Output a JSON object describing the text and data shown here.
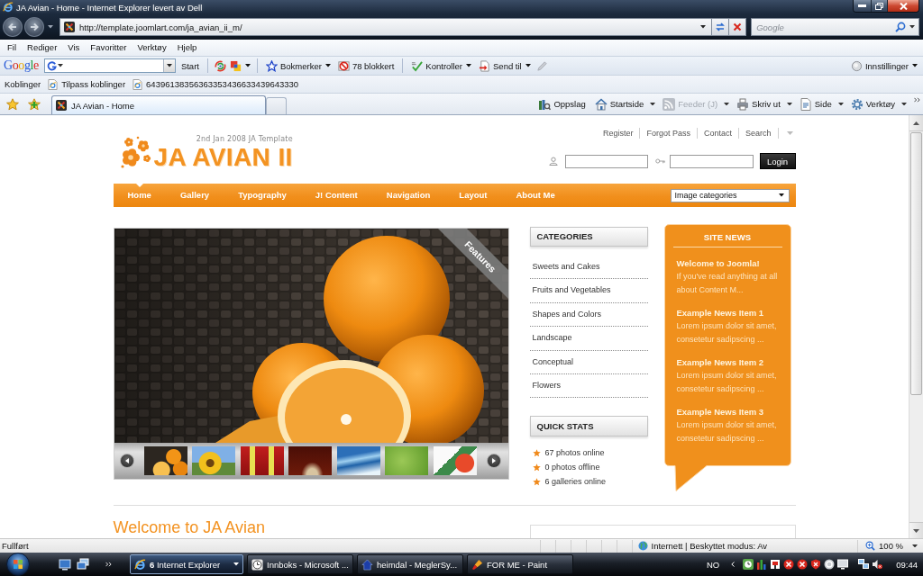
{
  "window": {
    "title": "JA Avian - Home - Internet Explorer levert av Dell"
  },
  "address_bar": {
    "url": "http://template.joomlart.com/ja_avian_ii_m/"
  },
  "search_box": {
    "placeholder": "Google"
  },
  "menu_bar": [
    "Fil",
    "Rediger",
    "Vis",
    "Favoritter",
    "Verktøy",
    "Hjelp"
  ],
  "google_toolbar": {
    "logo": "Google",
    "search_button": "Start",
    "bookmarks": "Bokmerker",
    "popups_blocked": "78 blokkert",
    "check": "Kontroller",
    "send_to": "Send til",
    "settings": "Innstillinger"
  },
  "links_bar": {
    "label": "Koblinger",
    "links": [
      "Tilpass koblinger",
      "64396138356363353436633439643330"
    ]
  },
  "tabs": [
    {
      "title": "JA Avian - Home",
      "selected": true
    }
  ],
  "command_bar": [
    {
      "label": "Oppslag",
      "dropdown": false,
      "disabled": false
    },
    {
      "label": "Startside",
      "dropdown": true,
      "disabled": false
    },
    {
      "label": "Feeder (J)",
      "dropdown": true,
      "disabled": true
    },
    {
      "label": "Skriv ut",
      "dropdown": true,
      "disabled": false
    },
    {
      "label": "Side",
      "dropdown": true,
      "disabled": false
    },
    {
      "label": "Verktøy",
      "dropdown": true,
      "disabled": false
    }
  ],
  "page": {
    "header": {
      "date_line": "2nd Jan 2008 JA Template",
      "logo": "JA AVIAN II",
      "top_links": [
        "Register",
        "Forgot Pass",
        "Contact",
        "Search"
      ],
      "login_button": "Login"
    },
    "nav": {
      "items": [
        {
          "label": "Home",
          "selected": true
        },
        {
          "label": "Gallery",
          "selected": false
        },
        {
          "label": "Typography",
          "selected": false
        },
        {
          "label": "J! Content",
          "selected": false
        },
        {
          "label": "Navigation",
          "selected": false
        },
        {
          "label": "Layout",
          "selected": false
        },
        {
          "label": "About Me",
          "selected": false
        }
      ],
      "category_select": "Image categories"
    },
    "slideshow": {
      "ribbon": "Features"
    },
    "categories": {
      "title": "CATEGORIES",
      "items": [
        "Sweets and Cakes",
        "Fruits and Vegetables",
        "Shapes and Colors",
        "Landscape",
        "Conceptual",
        "Flowers"
      ]
    },
    "quick_stats": {
      "title": "QUICK STATS",
      "items": [
        "67 photos online",
        "0 photos offline",
        "6 galleries online"
      ]
    },
    "site_news": {
      "title": "SITE NEWS",
      "items": [
        {
          "title": "Welcome to Joomla!",
          "summary": "If you've read anything at all about Content M..."
        },
        {
          "title": "Example News Item 1",
          "summary": "Lorem ipsum dolor sit amet, consetetur sadipscing ..."
        },
        {
          "title": "Example News Item 2",
          "summary": "Lorem ipsum dolor sit amet, consetetur sadipscing ..."
        },
        {
          "title": "Example News Item 3",
          "summary": "Lorem ipsum dolor sit amet, consetetur sadipscing ..."
        }
      ]
    },
    "welcome": {
      "heading": "Welcome to JA Avian"
    }
  },
  "status_bar": {
    "text": "Fullført",
    "zone": "Internett | Beskyttet modus: Av",
    "zoom": "100 %"
  },
  "taskbar": {
    "tasks": [
      {
        "label": "**6** Internet Explorer",
        "grouped": true,
        "selected": true
      },
      {
        "label": "Innboks - Microsoft ...",
        "grouped": false,
        "selected": false
      },
      {
        "label": "heimdal - MeglerSy...",
        "grouped": false,
        "selected": false
      },
      {
        "label": "FOR ME - Paint",
        "grouped": false,
        "selected": false
      }
    ],
    "language": "NO",
    "clock": "09:44"
  }
}
